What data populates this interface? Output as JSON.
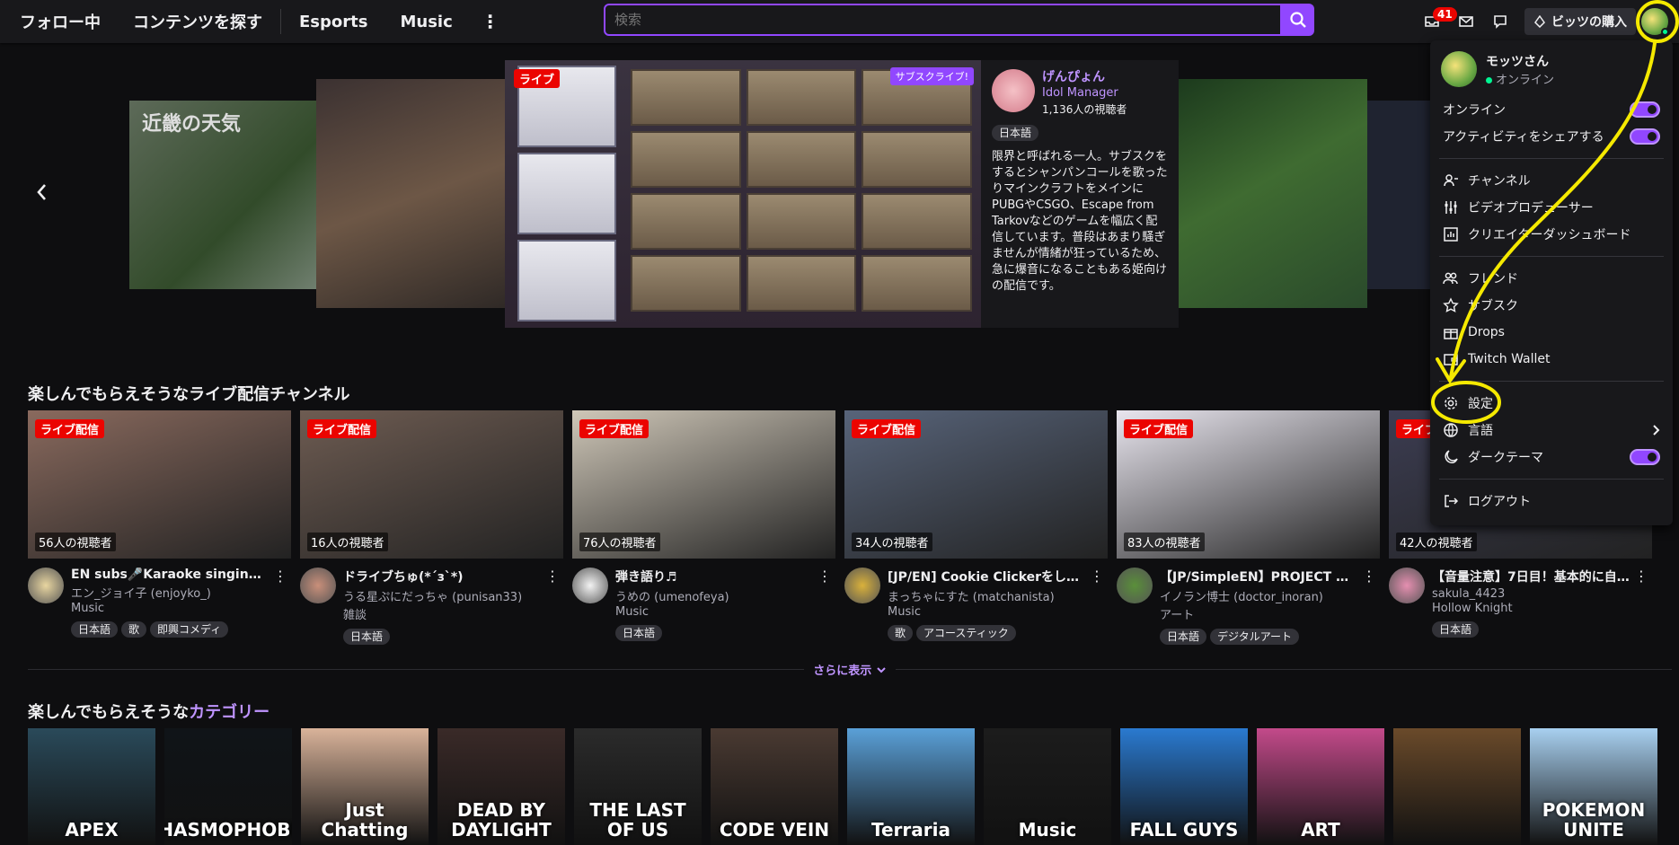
{
  "nav": {
    "items": [
      "フォロー中",
      "コンテンツを探す",
      "Esports",
      "Music"
    ],
    "more": "⋮",
    "search_placeholder": "検索",
    "notif_count": "41",
    "bits_label": "ビッツの購入"
  },
  "featured": {
    "live": "ライブ",
    "subscribe": "サブスクライブ!",
    "name": "げんぴょん",
    "game": "Idol Manager",
    "viewers": "1,136人の視聴者",
    "tag": "日本語",
    "description": "限界と呼ばれる一人。サブスクをするとシャンパンコールを歌ったりマインクラフトをメインにPUBGやCSGO、Escape from Tarkovなどのゲームを幅広く配信しています。普段はあまり騒ぎませんが情緒が狂っているため、急に爆音になることもある姫向けの配信です。",
    "side_left_text": "近畿の天気"
  },
  "section_live": {
    "title_prefix": "楽しんでもらえそうなライブ配信チャンネル",
    "live_label": "ライブ配信",
    "cards": [
      {
        "viewers": "56人の視聴者",
        "title": "EN subs🎤Karaoke singing🎶...",
        "channel": "エン_ジョイ子 (enjoyko_)",
        "game": "Music",
        "tags": [
          "日本語",
          "歌",
          "即興コメディ"
        ],
        "bg": "#8a6a5e",
        "av": "#e8d5a0"
      },
      {
        "viewers": "16人の視聴者",
        "title": "ドライブちゅ(*´з`*)",
        "channel": "うる星ぷにだっちゃ (punisan33)",
        "game": "雑談",
        "tags": [
          "日本語"
        ],
        "bg": "#6e5c52",
        "av": "#c98f7a"
      },
      {
        "viewers": "76人の視聴者",
        "title": "弾き語り♬",
        "channel": "うめの (umenofeya)",
        "game": "Music",
        "tags": [
          "日本語"
        ],
        "bg": "#cfc7b8",
        "av": "#f3f3f3"
      },
      {
        "viewers": "34人の視聴者",
        "title": "[JP/EN] Cookie Clickerをしな...",
        "channel": "まっちゃにすた (matchanista)",
        "game": "Music",
        "tags": [
          "歌",
          "アコースティック"
        ],
        "bg": "#58647a",
        "av": "#d9b13b"
      },
      {
        "viewers": "83人の視聴者",
        "title": "【JP/SimpleEN】PROJECT DR...",
        "channel": "イノラン博士 (doctor_inoran)",
        "game": "アート",
        "tags": [
          "日本語",
          "デジタルアート"
        ],
        "bg": "#e9e6ef",
        "av": "#5a8f3a"
      },
      {
        "viewers": "42人の視聴者",
        "title": "【音量注意】7日目！基本的に自...",
        "channel": "sakula_4423",
        "game": "Hollow Knight",
        "tags": [
          "日本語"
        ],
        "bg": "#3c3d52",
        "av": "#e58fb0"
      }
    ],
    "show_more": "さらに表示"
  },
  "section_cat": {
    "title_prefix": "楽しんでもらえそうな",
    "title_accent": "カテゴリー",
    "items": [
      {
        "label": "APEX",
        "bg": "#2a4a5a"
      },
      {
        "label": "PHASMOPHOBIA",
        "bg": "#101418"
      },
      {
        "label": "Just Chatting",
        "bg": "#d9b39a"
      },
      {
        "label": "DEAD BY DAYLIGHT",
        "bg": "#3a2a28"
      },
      {
        "label": "THE LAST OF US",
        "bg": "#2b2b2b"
      },
      {
        "label": "CODE VEIN",
        "bg": "#4a3a32"
      },
      {
        "label": "Terraria",
        "bg": "#5aa0d8"
      },
      {
        "label": "Music",
        "bg": "#1c1c1c"
      },
      {
        "label": "FALL GUYS",
        "bg": "#2a7ad0"
      },
      {
        "label": "ART",
        "bg": "#c34a8a"
      },
      {
        "label": "",
        "bg": "#6a4a2a"
      },
      {
        "label": "POKEMON UNITE",
        "bg": "#a8d0f0"
      }
    ]
  },
  "menu": {
    "user_name": "モッツさん",
    "user_status": "オンライン",
    "online_label": "オンライン",
    "share_activity": "アクティビティをシェアする",
    "channel": "チャンネル",
    "video_producer": "ビデオプロデューサー",
    "creator_dashboard": "クリエイターダッシュボード",
    "friends": "フレンド",
    "subs": "サブスク",
    "drops": "Drops",
    "wallet": "Twitch Wallet",
    "settings": "設定",
    "language": "言語",
    "dark_theme": "ダークテーマ",
    "logout": "ログアウト"
  },
  "colors": {
    "accent": "#9147ff",
    "live": "#eb0400",
    "annotation": "#f5e900"
  }
}
